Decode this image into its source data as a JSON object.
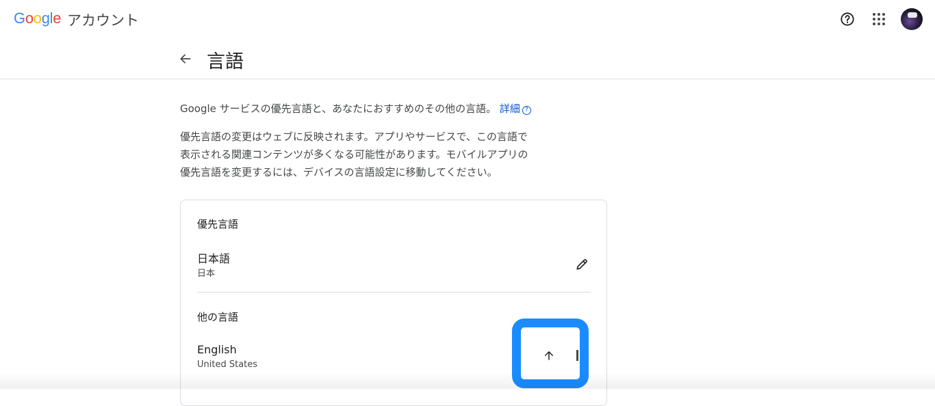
{
  "header": {
    "logo_letters": [
      "G",
      "o",
      "o",
      "g",
      "l",
      "e"
    ],
    "product": "アカウント",
    "help_icon": "help-circle-icon",
    "apps_icon": "apps-grid-icon"
  },
  "page": {
    "title": "言語",
    "back_icon": "arrow-back-icon"
  },
  "intro": {
    "text": "Google サービスの優先言語と、あなたにおすすめのその他の言語。",
    "link": "詳細"
  },
  "description": [
    "優先言語の変更はウェブに反映されます。アプリやサービスで、この言語で",
    "表示される関連コンテンツが多くなる可能性があります。モバイルアプリの",
    "優先言語を変更するには、デバイスの言語設定に移動してください。"
  ],
  "preferred": {
    "section_title": "優先言語",
    "language": "日本語",
    "region": "日本",
    "edit_icon": "pencil-icon"
  },
  "other": {
    "section_title": "他の言語",
    "language": "English",
    "region": "United States",
    "move_up_icon": "arrow-up-icon"
  },
  "colors": {
    "accent_link": "#0b57d0",
    "highlight": "#1a8cff",
    "divider": "#dadce0"
  }
}
